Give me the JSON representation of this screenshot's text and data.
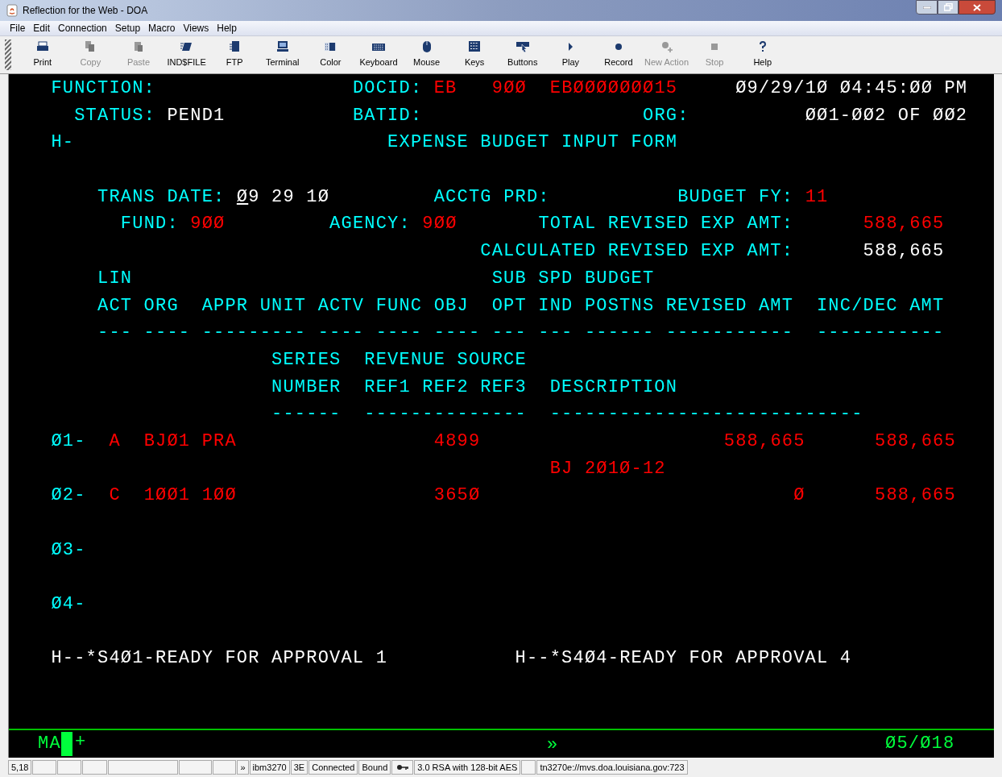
{
  "window": {
    "title": "Reflection for the Web - DOA"
  },
  "menu": [
    {
      "label": "File"
    },
    {
      "label": "Edit"
    },
    {
      "label": "Connection"
    },
    {
      "label": "Setup"
    },
    {
      "label": "Macro"
    },
    {
      "label": "Views"
    },
    {
      "label": "Help"
    }
  ],
  "toolbar": [
    {
      "label": "Print",
      "disabled": false
    },
    {
      "label": "Copy",
      "disabled": true
    },
    {
      "label": "Paste",
      "disabled": true
    },
    {
      "label": "IND$FILE",
      "disabled": false
    },
    {
      "label": "FTP",
      "disabled": false
    },
    {
      "label": "Terminal",
      "disabled": false
    },
    {
      "label": "Color",
      "disabled": false
    },
    {
      "label": "Keyboard",
      "disabled": false
    },
    {
      "label": "Mouse",
      "disabled": false
    },
    {
      "label": "Keys",
      "disabled": false
    },
    {
      "label": "Buttons",
      "disabled": false
    },
    {
      "label": "Play",
      "disabled": false
    },
    {
      "label": "Record",
      "disabled": false
    },
    {
      "label": "New Action",
      "disabled": true
    },
    {
      "label": "Stop",
      "disabled": true
    },
    {
      "label": "Help",
      "disabled": false
    }
  ],
  "terminal": {
    "rows": [
      {
        "segments": [
          {
            "text": " FUNCTION:",
            "color": "#00ffff"
          },
          {
            "text": "                 DOCID:",
            "color": "#00ffff"
          },
          {
            "text": " EB",
            "color": "#ff0000"
          },
          {
            "text": "   9ØØ",
            "color": "#ff0000"
          },
          {
            "text": "  EBØØØØØØØ15",
            "color": "#ff0000"
          },
          {
            "text": "     Ø9/29/1Ø Ø4:45:ØØ PM",
            "color": "#ffffff"
          }
        ]
      },
      {
        "segments": [
          {
            "text": "   STATUS:",
            "color": "#00ffff"
          },
          {
            "text": " PEND1",
            "color": "#ffffff"
          },
          {
            "text": "           BATID:",
            "color": "#00ffff"
          },
          {
            "text": "                   ORG:",
            "color": "#00ffff"
          },
          {
            "text": "          ØØ1-ØØ2 OF ØØ2",
            "color": "#ffffff"
          }
        ]
      },
      {
        "segments": [
          {
            "text": " H-",
            "color": "#00ffff"
          },
          {
            "text": "                           EXPENSE BUDGET INPUT FORM",
            "color": "#00ffff"
          }
        ]
      },
      {
        "segments": []
      },
      {
        "segments": [
          {
            "text": "     TRANS DATE:",
            "color": "#00ffff"
          },
          {
            "text": " Ø9 29 1Ø",
            "color": "#ffffff",
            "cursor": true
          },
          {
            "text": "         ACCTG PRD:",
            "color": "#00ffff"
          },
          {
            "text": "           BUDGET FY:",
            "color": "#00ffff"
          },
          {
            "text": " 11",
            "color": "#ff0000"
          }
        ]
      },
      {
        "segments": [
          {
            "text": "       FUND:",
            "color": "#00ffff"
          },
          {
            "text": " 9ØØ",
            "color": "#ff0000"
          },
          {
            "text": "         AGENCY:",
            "color": "#00ffff"
          },
          {
            "text": " 9ØØ",
            "color": "#ff0000"
          },
          {
            "text": "       TOTAL REVISED EXP AMT:",
            "color": "#00ffff"
          },
          {
            "text": "      588,665",
            "color": "#ff0000"
          }
        ]
      },
      {
        "segments": [
          {
            "text": "                                      CALCULATED REVISED EXP AMT:",
            "color": "#00ffff"
          },
          {
            "text": "      588,665",
            "color": "#ffffff"
          }
        ]
      },
      {
        "segments": [
          {
            "text": "     LIN",
            "color": "#00ffff"
          },
          {
            "text": "                               SUB SPD BUDGET",
            "color": "#00ffff"
          }
        ]
      },
      {
        "segments": [
          {
            "text": "     ACT ORG  APPR UNIT ACTV FUNC OBJ  OPT IND POSTNS REVISED AMT  INC/DEC AMT",
            "color": "#00ffff"
          }
        ]
      },
      {
        "segments": [
          {
            "text": "     --- ---- --------- ---- ---- ---- --- --- ------ -----------  -----------",
            "color": "#00ffff"
          }
        ]
      },
      {
        "segments": [
          {
            "text": "                    SERIES",
            "color": "#00ffff"
          },
          {
            "text": "  REVENUE SOURCE",
            "color": "#00ffff"
          }
        ]
      },
      {
        "segments": [
          {
            "text": "                    NUMBER  REF1 REF2 REF3  DESCRIPTION",
            "color": "#00ffff"
          }
        ]
      },
      {
        "segments": [
          {
            "text": "                    ------  --------------  ---------------------------",
            "color": "#00ffff"
          }
        ]
      },
      {
        "segments": [
          {
            "text": " Ø1-",
            "color": "#00ffff"
          },
          {
            "text": "  A",
            "color": "#ff0000"
          },
          {
            "text": "  BJØ1",
            "color": "#ff0000"
          },
          {
            "text": " PRA",
            "color": "#ff0000"
          },
          {
            "text": "                 4899",
            "color": "#ff0000"
          },
          {
            "text": "                     588,665",
            "color": "#ff0000"
          },
          {
            "text": "      588,665",
            "color": "#ff0000"
          }
        ]
      },
      {
        "segments": [
          {
            "text": "                                            BJ 2Ø1Ø-12",
            "color": "#ff0000"
          }
        ]
      },
      {
        "segments": [
          {
            "text": " Ø2-",
            "color": "#00ffff"
          },
          {
            "text": "  C",
            "color": "#ff0000"
          },
          {
            "text": "  1ØØ1",
            "color": "#ff0000"
          },
          {
            "text": " 1ØØ",
            "color": "#ff0000"
          },
          {
            "text": "                 365Ø",
            "color": "#ff0000"
          },
          {
            "text": "                           Ø",
            "color": "#ff0000"
          },
          {
            "text": "      588,665",
            "color": "#ff0000"
          }
        ]
      },
      {
        "segments": []
      },
      {
        "segments": [
          {
            "text": " Ø3-",
            "color": "#00ffff"
          }
        ]
      },
      {
        "segments": []
      },
      {
        "segments": [
          {
            "text": " Ø4-",
            "color": "#00ffff"
          }
        ]
      },
      {
        "segments": []
      },
      {
        "segments": [
          {
            "text": " H--*S4Ø1-READY FOR APPROVAL 1",
            "color": "#ffffff"
          },
          {
            "text": "           H--*S4Ø4-READY FOR APPROVAL 4",
            "color": "#ffffff"
          }
        ]
      },
      {
        "segments": []
      },
      {
        "segments": []
      }
    ],
    "oia": {
      "mode": "MA",
      "insert": "+",
      "indicator": "»",
      "position": "Ø5/Ø18"
    }
  },
  "status_bar": [
    {
      "text": "5,18"
    },
    {
      "text": "»"
    },
    {
      "text": "ibm3270"
    },
    {
      "text": "3E"
    },
    {
      "text": "Connected"
    },
    {
      "text": "Bound"
    },
    {
      "text": "3.0 RSA with 128-bit AES"
    },
    {
      "text": "tn3270e://mvs.doa.louisiana.gov:723"
    }
  ]
}
